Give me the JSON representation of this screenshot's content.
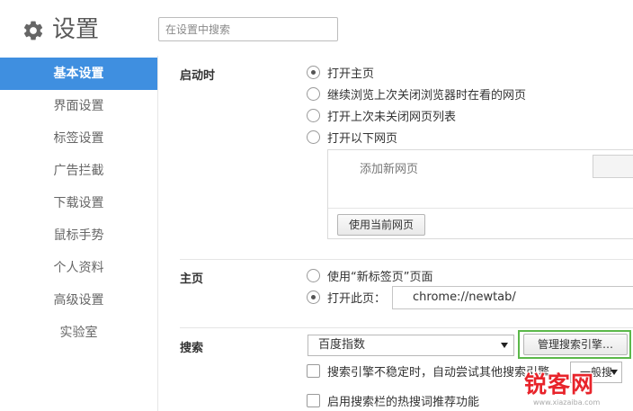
{
  "header": {
    "icon": "gear-icon",
    "title": "设置",
    "search_placeholder": "在设置中搜索"
  },
  "sidebar": {
    "items": [
      {
        "label": "基本设置",
        "active": true
      },
      {
        "label": "界面设置",
        "active": false
      },
      {
        "label": "标签设置",
        "active": false
      },
      {
        "label": "广告拦截",
        "active": false
      },
      {
        "label": "下载设置",
        "active": false
      },
      {
        "label": "鼠标手势",
        "active": false
      },
      {
        "label": "个人资料",
        "active": false
      },
      {
        "label": "高级设置",
        "active": false
      },
      {
        "label": "实验室",
        "active": false
      }
    ],
    "active_color": "#3f8fe0"
  },
  "startup": {
    "label": "启动时",
    "options": [
      {
        "label": "打开主页",
        "selected": true
      },
      {
        "label": "继续浏览上次关闭浏览器时在看的网页",
        "selected": false
      },
      {
        "label": "打开上次未关闭网页列表",
        "selected": false
      },
      {
        "label": "打开以下网页",
        "selected": false
      }
    ],
    "add_page_placeholder": "添加新网页",
    "use_current_button": "使用当前网页"
  },
  "homepage": {
    "label": "主页",
    "options": [
      {
        "label": "使用“新标签页”页面",
        "selected": false
      },
      {
        "label": "打开此页：",
        "selected": true
      }
    ],
    "url_value": "chrome://newtab/"
  },
  "search": {
    "label": "搜索",
    "engine_selected": "百度指数",
    "manage_button": "管理搜索引擎…",
    "manage_highlight_color": "#5bb84a",
    "fallback_option": {
      "label": "搜索引擎不稳定时，自动尝试其他搜索引擎",
      "checked": false
    },
    "fallback_select_value": "一般搜",
    "hotwords_option": {
      "label": "启用搜索栏的热搜词推荐功能",
      "checked": false
    }
  },
  "watermark": {
    "text": "锐客网",
    "url": "www.xiazaiba.com"
  }
}
